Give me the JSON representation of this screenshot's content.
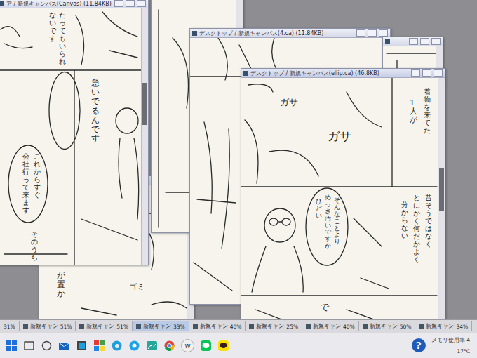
{
  "windows": [
    {
      "active": false,
      "texts": [
        "が置か",
        "ゴミ"
      ]
    },
    {
      "active": false,
      "texts": []
    },
    {
      "title": "デスクトップ / 新規キャンバス(4.ca) (11.84KB)",
      "active": false,
      "texts": [],
      "scroll": 0.5
    },
    {
      "active": false,
      "texts": []
    },
    {
      "title": "ア / 新規キャンバス(Canvas) (11.84KB)",
      "active": false,
      "texts": [
        "たってもいられ",
        "ないです",
        "急いでるんです",
        "これからすぐ",
        "会社行って来ます",
        "そのうち"
      ],
      "scroll": 0.35
    },
    {
      "title": "デスクトップ / 新規キャンバス(ellip.ca) (46.8KB)",
      "active": true,
      "texts": [
        "ガサ",
        "ガサ",
        "1人が",
        "着物を来てた",
        "昔そうではなく",
        "とにかく何だかよく",
        "分からない",
        "そんなことより",
        "めっさ汚いですか",
        "ひどい",
        "で"
      ],
      "scroll": 0.45
    }
  ],
  "canvas_tabs": [
    {
      "zoom": "31%",
      "selected": false
    },
    {
      "label": "新規キャン",
      "zoom": "51%",
      "selected": false
    },
    {
      "label": "新規キャン",
      "zoom": "51%",
      "selected": false
    },
    {
      "label": "新規キャン",
      "zoom": "33%",
      "selected": true
    },
    {
      "label": "新規キャン",
      "zoom": "40%",
      "selected": false
    },
    {
      "label": "新規キャン",
      "zoom": "25%",
      "selected": false
    },
    {
      "label": "新規キャン",
      "zoom": "40%",
      "selected": false
    },
    {
      "label": "新規キャン",
      "zoom": "50%",
      "selected": false
    },
    {
      "label": "新規キャン",
      "zoom": "34%",
      "selected": false
    }
  ],
  "taskbar": {
    "app_glyph": "w",
    "help": "?",
    "memory": "メモリ使用率 4",
    "temp": "17°C"
  }
}
